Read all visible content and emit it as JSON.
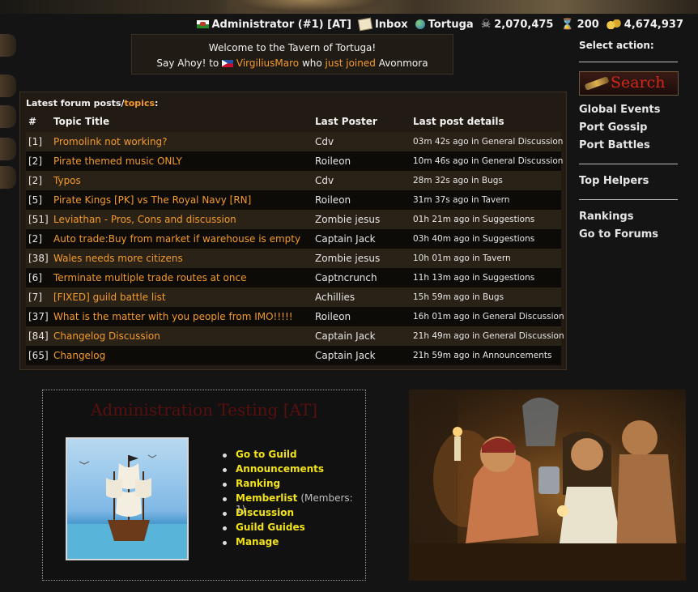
{
  "statusbar": {
    "user": "Administrator (#1) [AT]",
    "inbox": "Inbox",
    "location": "Tortuga",
    "gold_skull": "2,070,475",
    "hourglass": "200",
    "coins": "4,674,937"
  },
  "welcome": {
    "line1": "Welcome to the Tavern of Tortuga!",
    "say_ahoy": "Say Ahoy! to",
    "player": "VirgiliusMaro",
    "who": "who",
    "just_joined": "just joined",
    "server": "Avonmora"
  },
  "forum": {
    "title_prefix": "Latest forum posts/",
    "title_link": "topics",
    "title_suffix": ":",
    "headers": {
      "num": "#",
      "topic": "Topic Title",
      "poster": "Last Poster",
      "details": "Last post details"
    },
    "rows": [
      {
        "num": "[1]",
        "topic": "Promolink not working?",
        "poster": "Cdv",
        "details": "03m 42s ago in General Discussion"
      },
      {
        "num": "[2]",
        "topic": "Pirate themed music ONLY",
        "poster": "Roileon",
        "details": "10m 46s ago in General Discussion"
      },
      {
        "num": "[2]",
        "topic": "Typos",
        "poster": "Cdv",
        "details": "28m 32s ago in Bugs"
      },
      {
        "num": "[5]",
        "topic": "Pirate Kings [PK] vs The Royal Navy [RN]",
        "poster": "Roileon",
        "details": "31m 37s ago in Tavern"
      },
      {
        "num": "[51]",
        "topic": "Leviathan - Pros, Cons and discussion",
        "poster": "Zombie jesus",
        "details": "01h 21m ago in Suggestions"
      },
      {
        "num": "[2]",
        "topic": "Auto trade:Buy from market if warehouse is empty",
        "poster": "Captain Jack",
        "details": "03h 40m ago in Suggestions"
      },
      {
        "num": "[38]",
        "topic": "Wales needs more citizens",
        "poster": "Zombie jesus",
        "details": "10h 01m ago in Tavern"
      },
      {
        "num": "[6]",
        "topic": "Terminate multiple trade routes at once",
        "poster": "Captncrunch",
        "details": "11h 13m ago in Suggestions"
      },
      {
        "num": "[7]",
        "topic": "[FIXED] guild battle list",
        "poster": "Achillies",
        "details": "15h 59m ago in Bugs"
      },
      {
        "num": "[37]",
        "topic": "What is the matter with you people from IMO!!!!!",
        "poster": "Roileon",
        "details": "16h 01m ago in General Discussion"
      },
      {
        "num": "[84]",
        "topic": "Changelog Discussion",
        "poster": "Captain Jack",
        "details": "21h 49m ago in General Discussion"
      },
      {
        "num": "[65]",
        "topic": "Changelog",
        "poster": "Captain Jack",
        "details": "21h 59m ago in Announcements"
      }
    ]
  },
  "rightmenu": {
    "select_action": "Select action:",
    "search": "Search",
    "links1": [
      "Global Events",
      "Port Gossip",
      "Port Battles"
    ],
    "links2": [
      "Top Helpers"
    ],
    "links3": [
      "Rankings",
      "Go to Forums"
    ]
  },
  "guild": {
    "name": "Administration Testing [AT]",
    "links": [
      "Go to Guild",
      "Announcements",
      "Ranking",
      "Memberlist",
      "Discussion",
      "Guild Guides",
      "Manage"
    ],
    "members_note": "(Members: 1)"
  }
}
